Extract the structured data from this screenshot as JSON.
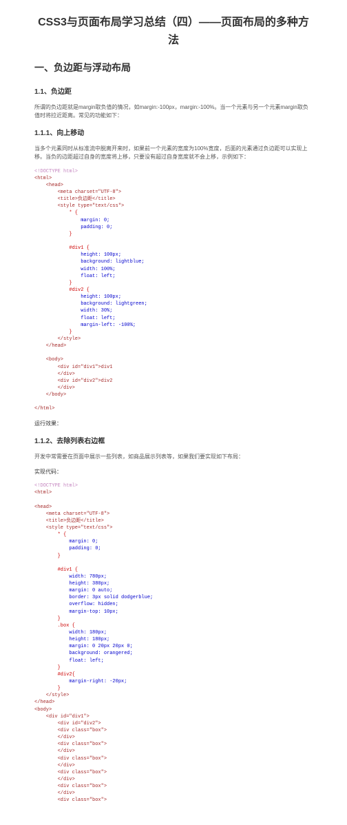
{
  "title": "CSS3与页面布局学习总结（四）——页面布局的多种方法",
  "section1": {
    "heading": "一、负边距与浮动布局",
    "sub1": {
      "heading": "1.1、负边距",
      "para": "所谓的负边距就是margin取负值的情况，如margin:-100px，margin:-100%。当一个元素与另一个元素margin取负值时将拉近距离。常见的功能如下："
    },
    "sub11": {
      "heading": "1.1.1、向上移动",
      "para": "当多个元素同时从标准流中脱离开来时，如果前一个元素的宽度为100%宽度，后面的元素通过负边距可以实现上移。当负的边距超过自身的宽度将上移，只要没有超过自身宽度就不会上移，示例如下："
    },
    "result_label": "运行效果：",
    "sub12": {
      "heading": "1.1.2、去除列表右边框",
      "para": "开发中常需要在页面中展示一些列表，如商品展示列表等，如果我们要实现如下布局："
    },
    "impl_label": "实现代码："
  },
  "code1_lines": [
    {
      "cls": "c-pink",
      "pad": 0,
      "t": "<!DOCTYPE html>"
    },
    {
      "cls": "c-brown",
      "pad": 0,
      "t": "<html>"
    },
    {
      "cls": "c-brown",
      "pad": 1,
      "t": "<head>"
    },
    {
      "cls": "c-brown",
      "pad": 2,
      "t": "<meta charset=\"UTF-8\">"
    },
    {
      "cls": "c-brown",
      "pad": 2,
      "t": "<title>负边距</title>"
    },
    {
      "cls": "c-brown",
      "pad": 2,
      "t": "<style type=\"text/css\">"
    },
    {
      "cls": "c-red",
      "pad": 3,
      "t": "* {"
    },
    {
      "cls": "c-blue",
      "pad": 4,
      "t": "margin: 0;"
    },
    {
      "cls": "c-blue",
      "pad": 4,
      "t": "padding: 0;"
    },
    {
      "cls": "c-red",
      "pad": 3,
      "t": "}"
    },
    {
      "cls": "c-plain",
      "pad": 3,
      "t": ""
    },
    {
      "cls": "c-red",
      "pad": 3,
      "t": "#div1 {"
    },
    {
      "cls": "c-blue",
      "pad": 4,
      "t": "height: 100px;"
    },
    {
      "cls": "c-blue",
      "pad": 4,
      "t": "background: lightblue;"
    },
    {
      "cls": "c-blue",
      "pad": 4,
      "t": "width: 100%;"
    },
    {
      "cls": "c-blue",
      "pad": 4,
      "t": "float: left;"
    },
    {
      "cls": "c-red",
      "pad": 3,
      "t": "}"
    },
    {
      "cls": "c-red",
      "pad": 3,
      "t": "#div2 {"
    },
    {
      "cls": "c-blue",
      "pad": 4,
      "t": "height: 100px;"
    },
    {
      "cls": "c-blue",
      "pad": 4,
      "t": "background: lightgreen;"
    },
    {
      "cls": "c-blue",
      "pad": 4,
      "t": "width: 30%;"
    },
    {
      "cls": "c-blue",
      "pad": 4,
      "t": "float: left;"
    },
    {
      "cls": "c-blue",
      "pad": 4,
      "t": "margin-left: -100%;"
    },
    {
      "cls": "c-red",
      "pad": 3,
      "t": "}"
    },
    {
      "cls": "c-brown",
      "pad": 2,
      "t": "</style>"
    },
    {
      "cls": "c-brown",
      "pad": 1,
      "t": "</head>"
    },
    {
      "cls": "c-plain",
      "pad": 1,
      "t": ""
    },
    {
      "cls": "c-brown",
      "pad": 1,
      "t": "<body>"
    },
    {
      "cls": "c-brown",
      "pad": 2,
      "t": "<div id=\"div1\">div1"
    },
    {
      "cls": "c-brown",
      "pad": 2,
      "t": "</div>"
    },
    {
      "cls": "c-brown",
      "pad": 2,
      "t": "<div id=\"div2\">div2"
    },
    {
      "cls": "c-brown",
      "pad": 2,
      "t": "</div>"
    },
    {
      "cls": "c-brown",
      "pad": 1,
      "t": "</body>"
    },
    {
      "cls": "c-plain",
      "pad": 0,
      "t": ""
    },
    {
      "cls": "c-brown",
      "pad": 0,
      "t": "</html>"
    }
  ],
  "code2_lines": [
    {
      "cls": "c-pink",
      "pad": 0,
      "t": "<!DOCTYPE html>"
    },
    {
      "cls": "c-brown",
      "pad": 0,
      "t": "<html>"
    },
    {
      "cls": "c-plain",
      "pad": 0,
      "t": ""
    },
    {
      "cls": "c-brown",
      "pad": 0,
      "t": "<head>"
    },
    {
      "cls": "c-brown",
      "pad": 1,
      "t": "<meta charset=\"UTF-8\">"
    },
    {
      "cls": "c-brown",
      "pad": 1,
      "t": "<title>负边距</title>"
    },
    {
      "cls": "c-brown",
      "pad": 1,
      "t": "<style type=\"text/css\">"
    },
    {
      "cls": "c-red",
      "pad": 2,
      "t": "* {"
    },
    {
      "cls": "c-blue",
      "pad": 3,
      "t": "margin: 0;"
    },
    {
      "cls": "c-blue",
      "pad": 3,
      "t": "padding: 0;"
    },
    {
      "cls": "c-red",
      "pad": 2,
      "t": "}"
    },
    {
      "cls": "c-plain",
      "pad": 2,
      "t": ""
    },
    {
      "cls": "c-red",
      "pad": 2,
      "t": "#div1 {"
    },
    {
      "cls": "c-blue",
      "pad": 3,
      "t": "width: 780px;"
    },
    {
      "cls": "c-blue",
      "pad": 3,
      "t": "height: 380px;"
    },
    {
      "cls": "c-blue",
      "pad": 3,
      "t": "margin: 0 auto;"
    },
    {
      "cls": "c-blue",
      "pad": 3,
      "t": "border: 3px solid dodgerblue;"
    },
    {
      "cls": "c-blue",
      "pad": 3,
      "t": "overflow: hidden;"
    },
    {
      "cls": "c-blue",
      "pad": 3,
      "t": "margin-top: 10px;"
    },
    {
      "cls": "c-red",
      "pad": 2,
      "t": "}"
    },
    {
      "cls": "c-red",
      "pad": 2,
      "t": ".box {"
    },
    {
      "cls": "c-blue",
      "pad": 3,
      "t": "width: 180px;"
    },
    {
      "cls": "c-blue",
      "pad": 3,
      "t": "height: 180px;"
    },
    {
      "cls": "c-blue",
      "pad": 3,
      "t": "margin: 0 20px 20px 0;"
    },
    {
      "cls": "c-blue",
      "pad": 3,
      "t": "background: orangered;"
    },
    {
      "cls": "c-blue",
      "pad": 3,
      "t": "float: left;"
    },
    {
      "cls": "c-red",
      "pad": 2,
      "t": "}"
    },
    {
      "cls": "c-red",
      "pad": 2,
      "t": "#div2{"
    },
    {
      "cls": "c-blue",
      "pad": 3,
      "t": "margin-right: -20px;"
    },
    {
      "cls": "c-red",
      "pad": 2,
      "t": "}"
    },
    {
      "cls": "c-brown",
      "pad": 1,
      "t": "</style>"
    },
    {
      "cls": "c-brown",
      "pad": 0,
      "t": "</head>"
    },
    {
      "cls": "c-brown",
      "pad": 0,
      "t": "<body>"
    },
    {
      "cls": "c-brown",
      "pad": 1,
      "t": "<div id=\"div1\">"
    },
    {
      "cls": "c-brown",
      "pad": 2,
      "t": "<div id=\"div2\">"
    },
    {
      "cls": "c-brown",
      "pad": 2,
      "t": "<div class=\"box\">"
    },
    {
      "cls": "c-brown",
      "pad": 2,
      "t": "</div>"
    },
    {
      "cls": "c-brown",
      "pad": 2,
      "t": "<div class=\"box\">"
    },
    {
      "cls": "c-brown",
      "pad": 2,
      "t": "</div>"
    },
    {
      "cls": "c-brown",
      "pad": 2,
      "t": "<div class=\"box\">"
    },
    {
      "cls": "c-brown",
      "pad": 2,
      "t": "</div>"
    },
    {
      "cls": "c-brown",
      "pad": 2,
      "t": "<div class=\"box\">"
    },
    {
      "cls": "c-brown",
      "pad": 2,
      "t": "</div>"
    },
    {
      "cls": "c-brown",
      "pad": 2,
      "t": "<div class=\"box\">"
    },
    {
      "cls": "c-brown",
      "pad": 2,
      "t": "</div>"
    },
    {
      "cls": "c-brown",
      "pad": 2,
      "t": "<div class=\"box\">"
    }
  ]
}
